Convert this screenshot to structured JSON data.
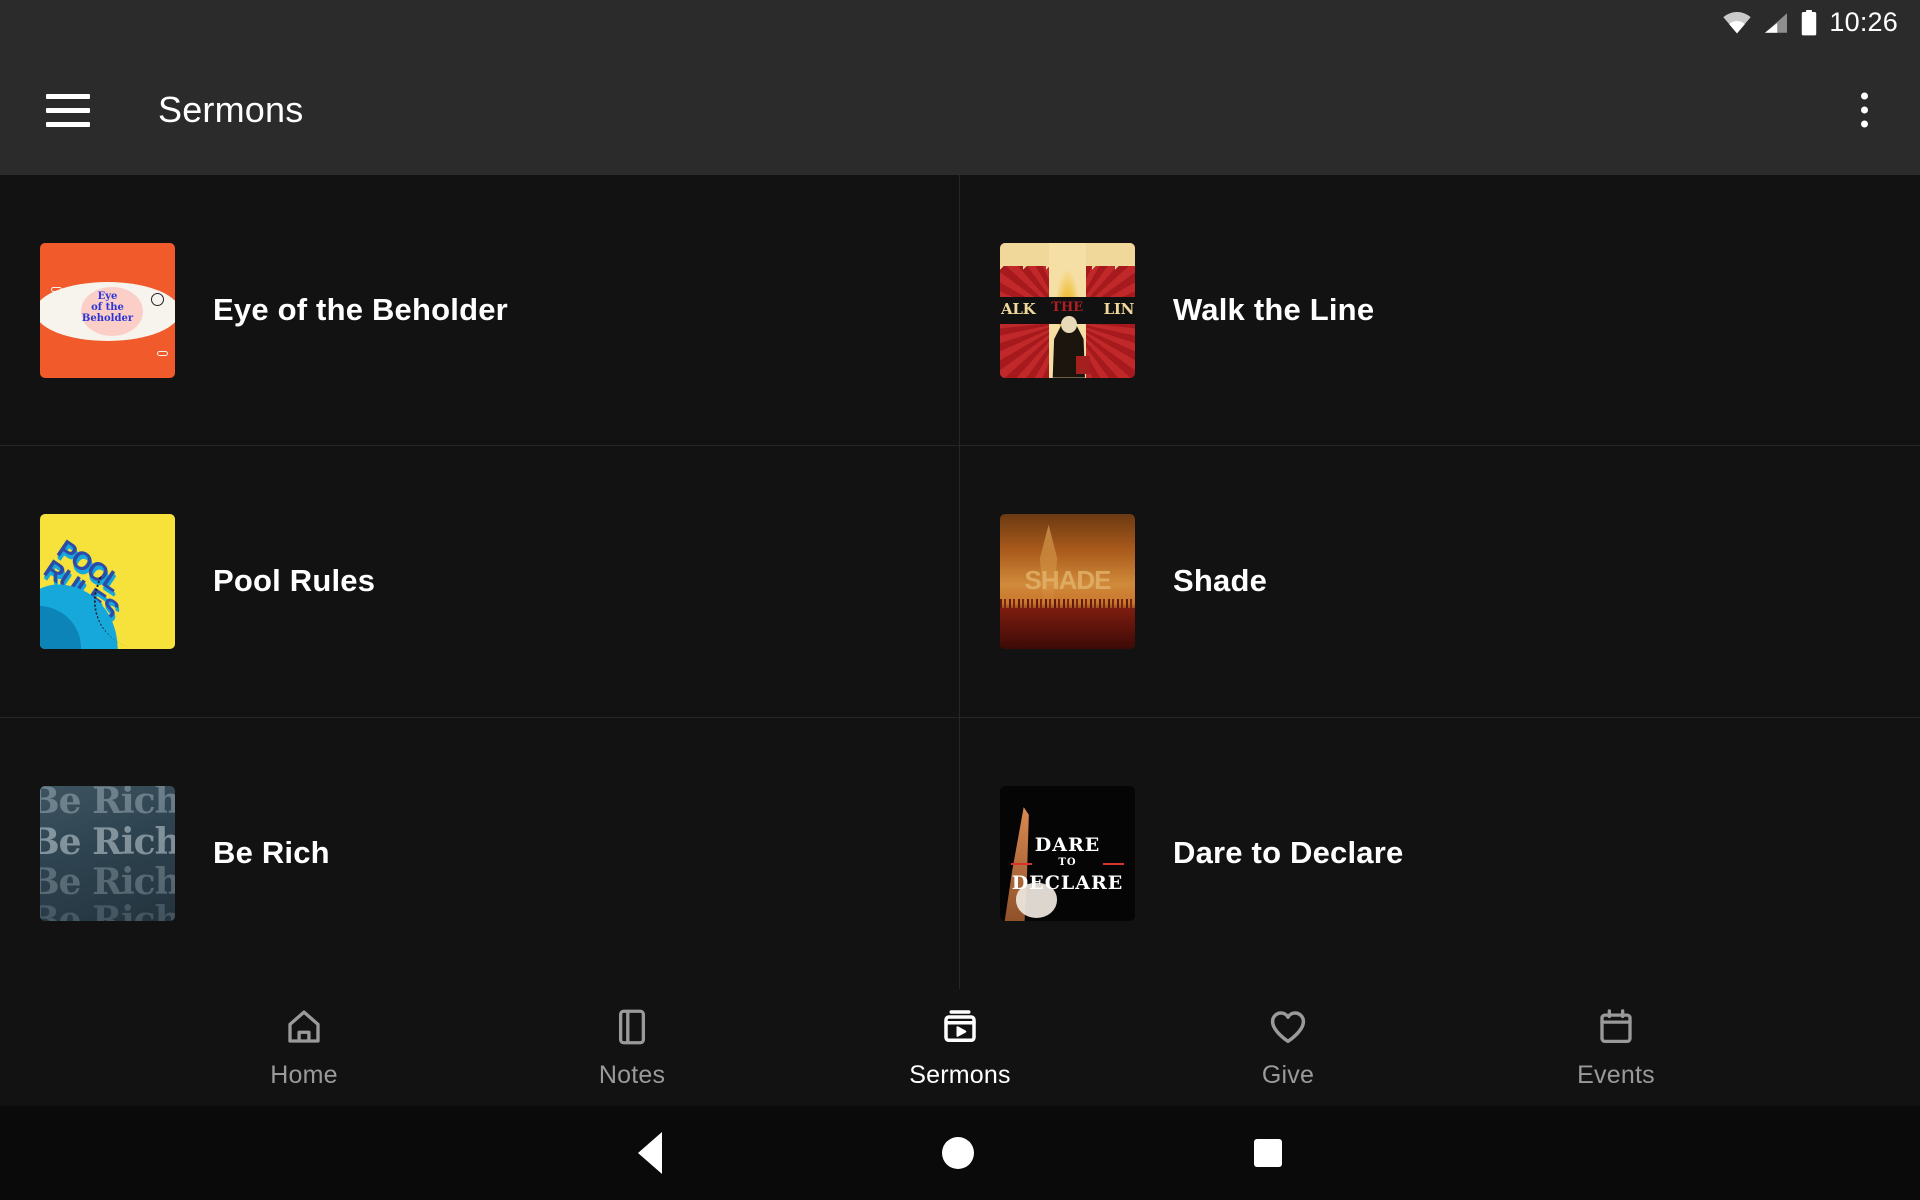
{
  "status_bar": {
    "wifi_icon": "wifi-icon",
    "signal_icon": "cell-signal-icon",
    "battery_icon": "battery-icon",
    "time": "10:26"
  },
  "app_bar": {
    "menu_icon": "hamburger-menu-icon",
    "title": "Sermons",
    "overflow_icon": "overflow-menu-icon"
  },
  "colors": {
    "background": "#121212",
    "app_bar": "#2b2b2b",
    "divider": "#262626",
    "text_primary": "#ffffff",
    "text_inactive": "#9a9a9a"
  },
  "sermon_series": [
    {
      "title": "Eye of the Beholder",
      "artwork_name": "eye-of-the-beholder-artwork",
      "artwork_text": "Eye\nof the\nBeholder",
      "artwork_colors": [
        "#f15a2b",
        "#f7f4ee",
        "#fbcfc8",
        "#2a34d8"
      ]
    },
    {
      "title": "Walk the Line",
      "artwork_name": "walk-the-line-artwork",
      "artwork_text": "ALK THE LIN",
      "artwork_colors": [
        "#b01f24",
        "#f6dfa4",
        "#111111"
      ]
    },
    {
      "title": "Pool Rules",
      "artwork_name": "pool-rules-artwork",
      "artwork_text": "POOL RULES",
      "artwork_colors": [
        "#f7e23c",
        "#17a8db",
        "#2c4ca8"
      ]
    },
    {
      "title": "Shade",
      "artwork_name": "shade-artwork",
      "artwork_text": "SHADE",
      "artwork_colors": [
        "#a8591b",
        "#d08a3a",
        "#4a0d08"
      ]
    },
    {
      "title": "Be Rich",
      "artwork_name": "be-rich-artwork",
      "artwork_text": "Be Rich",
      "artwork_colors": [
        "#3d5460",
        "#23333d"
      ]
    },
    {
      "title": "Dare to Declare",
      "artwork_name": "dare-to-declare-artwork",
      "artwork_text": "DARE TO DECLARE",
      "artwork_colors": [
        "#050505",
        "#ffffff",
        "#d9342b"
      ]
    }
  ],
  "bottom_nav": {
    "active": "Sermons",
    "items": [
      {
        "label": "Home",
        "icon": "home-icon",
        "active": false
      },
      {
        "label": "Notes",
        "icon": "notebook-icon",
        "active": false
      },
      {
        "label": "Sermons",
        "icon": "video-library-icon",
        "active": true
      },
      {
        "label": "Give",
        "icon": "heart-icon",
        "active": false
      },
      {
        "label": "Events",
        "icon": "calendar-icon",
        "active": false
      }
    ]
  },
  "system_nav": {
    "back_label": "Back",
    "home_label": "Home",
    "recents_label": "Recents"
  },
  "artwork_lines": {
    "eye_1": "Eye",
    "eye_2": "of the",
    "eye_3": "Beholder",
    "walk_left": "ALK",
    "walk_mid": "THE",
    "walk_right": "LIN",
    "pool_1": "POOL",
    "pool_2": "RULES",
    "shade": "SHADE",
    "berich": "Be Rich Be Rich Be",
    "dare_1": "DARE",
    "dare_2": "TO",
    "dare_3": "DECLARE"
  }
}
